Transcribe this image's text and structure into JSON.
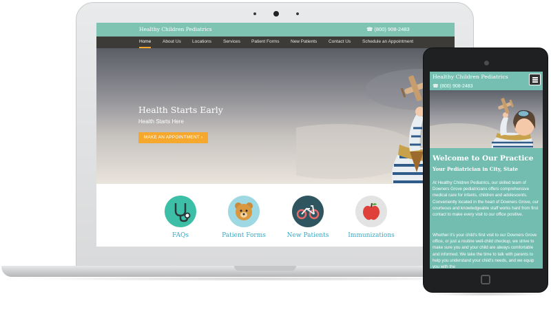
{
  "desktop_site": {
    "brand": "Healthy Children Pediatrics",
    "phone": "☎  (800) 908-2483",
    "nav": [
      {
        "label": "Home",
        "active": true
      },
      {
        "label": "About Us"
      },
      {
        "label": "Locations"
      },
      {
        "label": "Services"
      },
      {
        "label": "Patient Forms"
      },
      {
        "label": "New Patients"
      },
      {
        "label": "Contact Us"
      },
      {
        "label": "Schedule an Appointment"
      }
    ],
    "hero": {
      "title": "Health Starts Early",
      "subtitle": "Health Starts Here",
      "cta": "MAKE AN APPOINTMENT ›"
    },
    "features": [
      {
        "label": "FAQs",
        "icon": "stethoscope-icon",
        "color": "#3dbfa7"
      },
      {
        "label": "Patient Forms",
        "icon": "teddy-bear-icon",
        "color": "#9ed8e3"
      },
      {
        "label": "New Patients",
        "icon": "tricycle-icon",
        "color": "#2f5660"
      },
      {
        "label": "Immunizations",
        "icon": "apple-icon",
        "color": "#e3e3e3"
      }
    ]
  },
  "mobile_site": {
    "brand": "Healthy Children Pediatrics",
    "phone": "☎  (800) 908-2483",
    "heading": "Welcome to Our Practice",
    "subheading": "Your Pediatrician in City, State",
    "paragraph1": "At Healthy Children Pediatrics, our skilled team of Downers Grove pediatricians offers comprehensive medical care for infants, children and adolescents. Conveniently located in the heart of Downers Grove, our courteous and knowledgeable staff works hard from first contact to make every visit to our office positive.",
    "paragraph2": "Whether it's your child's first visit to our Downers Grove office, or just a routine well-child checkup, we strive to make sure you and your child are always comfortable and informed. We take the time to talk with parents to help you understand your child's needs, and we equip you with the"
  },
  "colors": {
    "teal": "#7fc3b3",
    "nav_dark": "#3c3b38",
    "accent_orange": "#f5a82c",
    "link_blue": "#3aa8c2"
  }
}
